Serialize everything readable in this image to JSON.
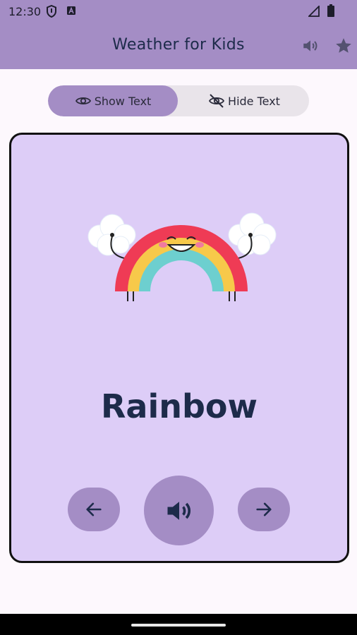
{
  "status_bar": {
    "time": "12:30",
    "icons": [
      "shield-icon",
      "a-notification-icon",
      "signal-icon",
      "battery-icon"
    ]
  },
  "app_bar": {
    "title": "Weather for Kids",
    "actions": [
      "sound-icon",
      "star-icon"
    ]
  },
  "toggle": {
    "show_label": "Show Text",
    "hide_label": "Hide Text",
    "selected": "show"
  },
  "card": {
    "word": "Rainbow",
    "illustration": "smiling-rainbow-with-clouds",
    "buttons": [
      "previous",
      "speak",
      "next"
    ]
  },
  "colors": {
    "primary": "#a48dc5",
    "card_background": "#ddcdf7",
    "text": "#1d2b4a",
    "page_background": "#fdf8fd"
  }
}
